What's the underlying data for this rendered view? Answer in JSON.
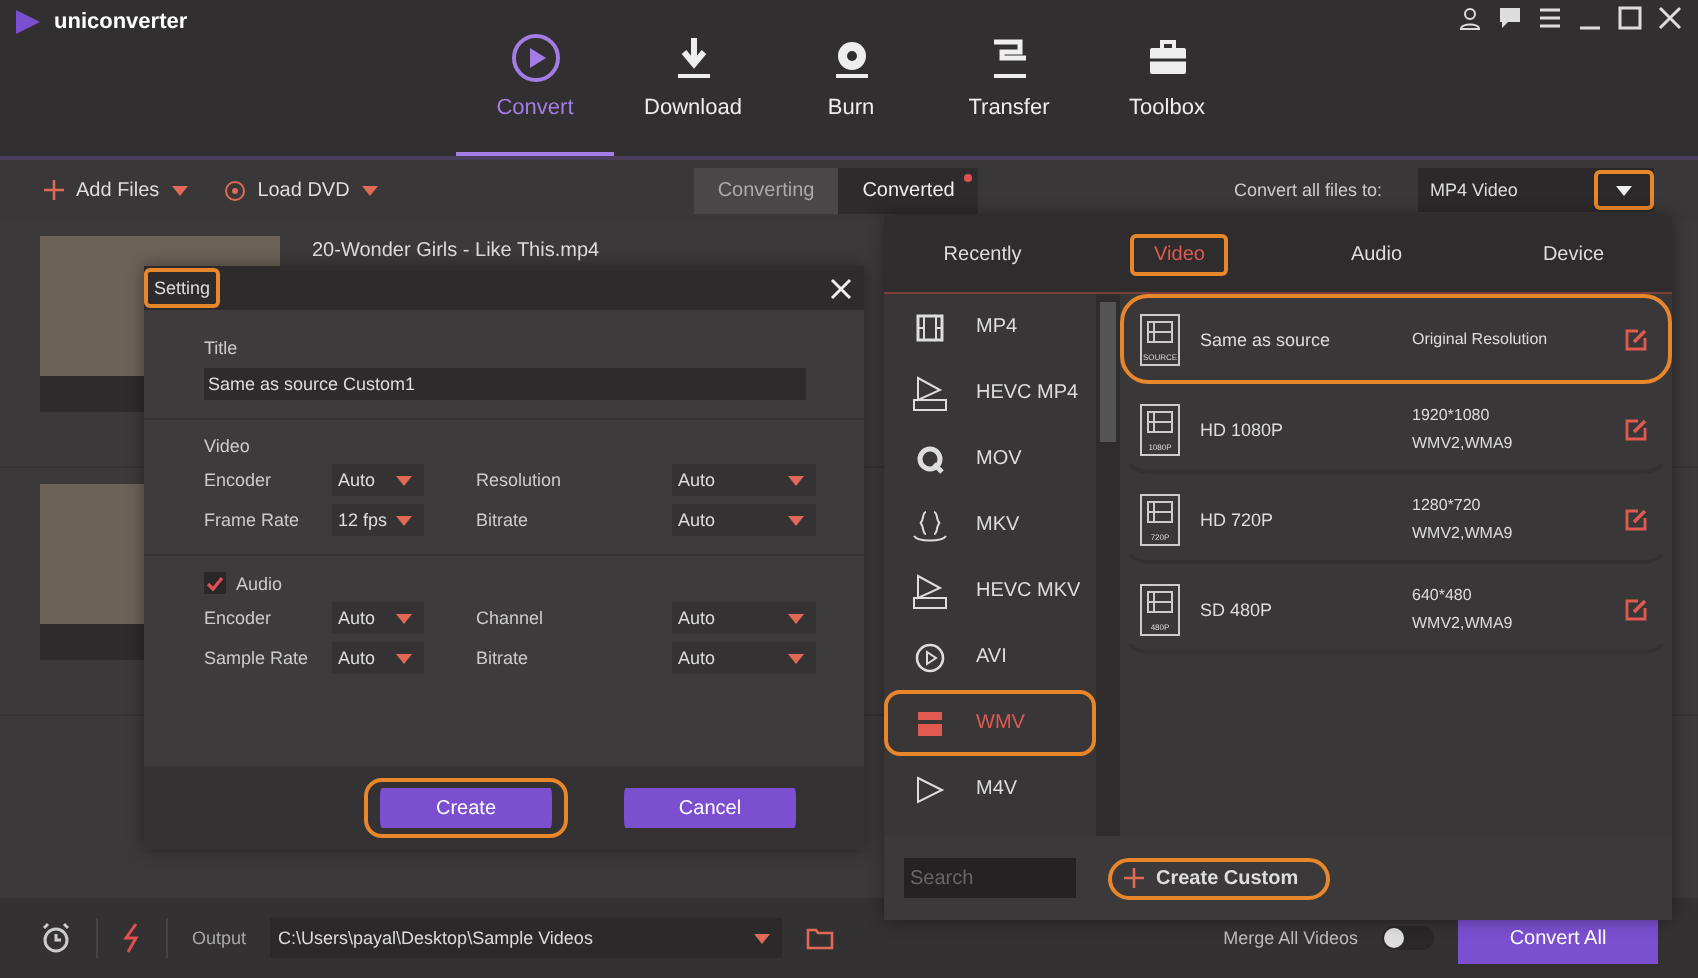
{
  "app": {
    "name": "uniconverter"
  },
  "nav_tabs": [
    {
      "label": "Convert",
      "kind": "convert",
      "selected": true
    },
    {
      "label": "Download",
      "kind": "download",
      "selected": false
    },
    {
      "label": "Burn",
      "kind": "burn",
      "selected": false
    },
    {
      "label": "Transfer",
      "kind": "transfer",
      "selected": false
    },
    {
      "label": "Toolbox",
      "kind": "toolbox",
      "selected": false
    }
  ],
  "toolbar": {
    "add_files": "Add Files",
    "load_dvd": "Load DVD",
    "view_tabs": [
      {
        "label": "Converting",
        "selected": true,
        "badge": false
      },
      {
        "label": "Converted",
        "selected": false,
        "badge": true
      }
    ],
    "convert_all_label": "Convert all files to:",
    "convert_all_value": "MP4 Video",
    "dropdown_highlighted": true
  },
  "files": [
    {
      "kind": "named",
      "name": "20-Wonder Girls - Like This.mp4"
    },
    {
      "kind": "covered"
    }
  ],
  "setting_dialog": {
    "title": "Setting",
    "title_highlighted": true,
    "title_label": "Title",
    "title_value": "Same as source Custom1",
    "video_label": "Video",
    "video_fields": [
      {
        "label": "Encoder",
        "value": "Auto"
      },
      {
        "label": "Resolution",
        "value": "Auto"
      },
      {
        "label": "Frame Rate",
        "value": "12 fps"
      },
      {
        "label": "Bitrate",
        "value": "Auto"
      }
    ],
    "audio_label": "Audio",
    "audio_checked": true,
    "audio_fields": [
      {
        "label": "Encoder",
        "value": "Auto"
      },
      {
        "label": "Channel",
        "value": "Auto"
      },
      {
        "label": "Sample Rate",
        "value": "Auto"
      },
      {
        "label": "Bitrate",
        "value": "Auto"
      }
    ],
    "buttons": [
      {
        "label": "Create",
        "highlighted": true
      },
      {
        "label": "Cancel",
        "highlighted": false
      }
    ]
  },
  "format_panel": {
    "tabs": [
      {
        "label": "Recently",
        "selected": false,
        "highlighted": false
      },
      {
        "label": "Video",
        "selected": true,
        "highlighted": true
      },
      {
        "label": "Audio",
        "selected": false,
        "highlighted": false
      },
      {
        "label": "Device",
        "selected": false,
        "highlighted": false
      }
    ],
    "formats": [
      {
        "label": "MP4",
        "kind": "film",
        "selected": false,
        "highlighted": false
      },
      {
        "label": "HEVC MP4",
        "kind": "hevc",
        "selected": false,
        "highlighted": false
      },
      {
        "label": "MOV",
        "kind": "q",
        "selected": false,
        "highlighted": false
      },
      {
        "label": "MKV",
        "kind": "braces",
        "selected": false,
        "highlighted": false
      },
      {
        "label": "HEVC MKV",
        "kind": "hevc",
        "selected": false,
        "highlighted": false
      },
      {
        "label": "AVI",
        "kind": "play",
        "selected": false,
        "highlighted": false
      },
      {
        "label": "WMV",
        "kind": "clapper",
        "selected": true,
        "highlighted": true
      },
      {
        "label": "M4V",
        "kind": "triangle",
        "selected": false,
        "highlighted": false
      }
    ],
    "presets": [
      {
        "name": "Same as source",
        "badge": "SOURCE",
        "details": [
          "Original Resolution"
        ],
        "highlighted": true
      },
      {
        "name": "HD 1080P",
        "badge": "1080P",
        "details": [
          "1920*1080",
          "WMV2,WMA9"
        ],
        "highlighted": false
      },
      {
        "name": "HD 720P",
        "badge": "720P",
        "details": [
          "1280*720",
          "WMV2,WMA9"
        ],
        "highlighted": false
      },
      {
        "name": "SD 480P",
        "badge": "480P",
        "details": [
          "640*480",
          "WMV2,WMA9"
        ],
        "highlighted": false
      }
    ],
    "search_placeholder": "Search",
    "create_custom": {
      "label": "Create Custom",
      "highlighted": true
    }
  },
  "bottom_bar": {
    "output_label": "Output",
    "output_path": "C:\\Users\\payal\\Desktop\\Sample Videos",
    "merge_label": "Merge All Videos",
    "merge_on": false,
    "convert_all": "Convert All"
  }
}
